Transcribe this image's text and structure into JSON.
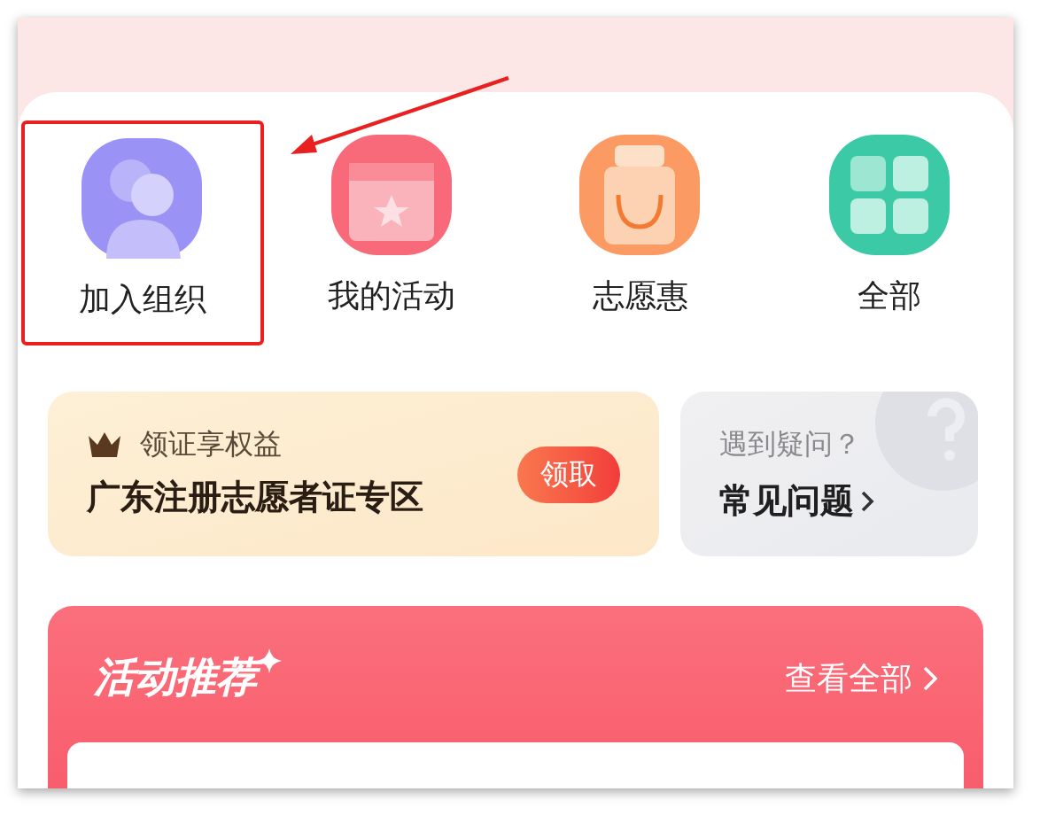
{
  "shortcuts": [
    {
      "label": "加入组织",
      "kind": "people",
      "highlighted": true
    },
    {
      "label": "我的活动",
      "kind": "calendar",
      "highlighted": false
    },
    {
      "label": "志愿惠",
      "kind": "bag",
      "highlighted": false
    },
    {
      "label": "全部",
      "kind": "grid",
      "highlighted": false
    }
  ],
  "certificate_card": {
    "caption": "领证享权益",
    "title": "广东注册志愿者证专区",
    "button": "领取"
  },
  "faq_card": {
    "caption": "遇到疑问？",
    "title": "常见问题"
  },
  "recommend": {
    "title": "活动推荐",
    "link": "查看全部"
  }
}
